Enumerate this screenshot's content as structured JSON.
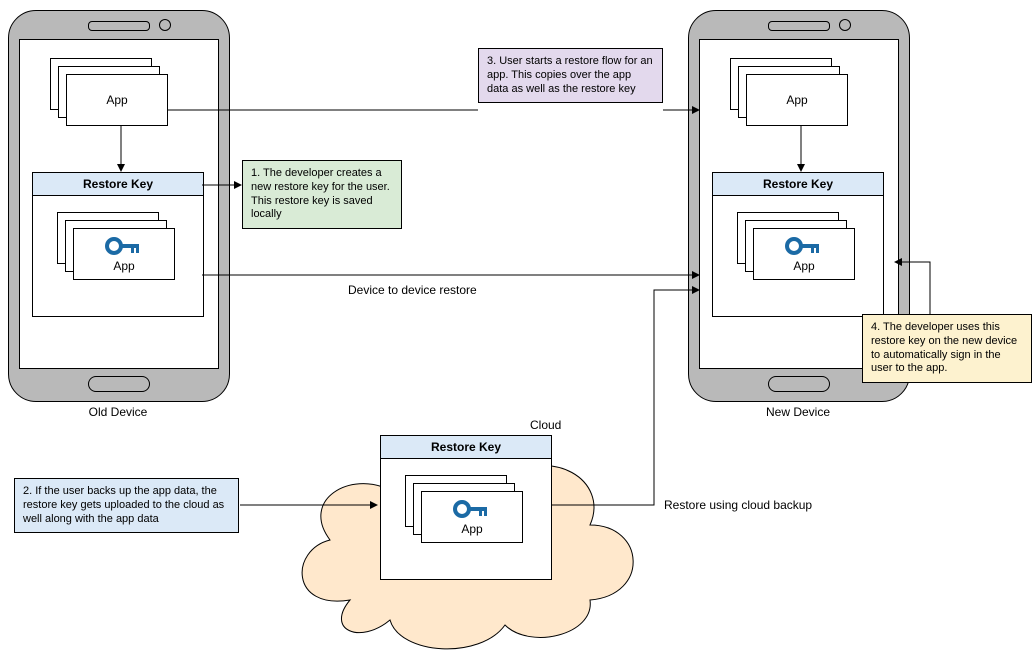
{
  "old_device": {
    "label": "Old Device",
    "app_label": "App"
  },
  "new_device": {
    "label": "New Device",
    "app_label": "App"
  },
  "restore_panel": {
    "title": "Restore Key",
    "app_label": "App"
  },
  "cloud": {
    "label": "Cloud"
  },
  "notes": {
    "n1": "1. The developer creates a new restore key for the user. This restore key is saved locally",
    "n2": "2. If the user backs up the app data, the restore key gets uploaded to the cloud as well along with the app data",
    "n3": "3. User starts a restore flow for an app. This copies over the app data as well as the restore key",
    "n4": "4. The developer uses this restore key on the new device to automatically sign in the user to the app."
  },
  "labels": {
    "d2d": "Device to device restore",
    "cloud_restore": "Restore using cloud backup"
  },
  "colors": {
    "phone_body": "#b9b9b9",
    "panel_header": "#dbe9f7",
    "note_green": "#d9ebd6",
    "note_blue": "#dbe9f7",
    "note_purple": "#e3d9ed",
    "note_yellow": "#fdf2cf",
    "cloud_fill": "#ffe8cc",
    "key_icon": "#1b6aa5"
  }
}
